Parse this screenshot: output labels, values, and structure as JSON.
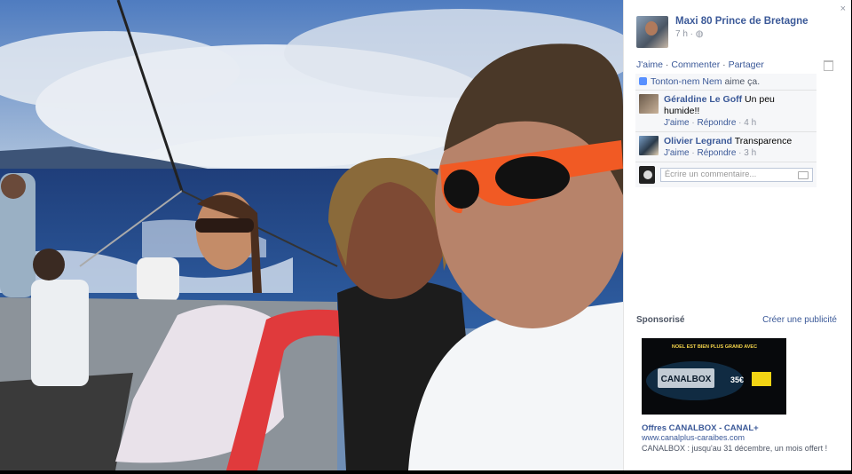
{
  "post": {
    "author": "Maxi 80 Prince de Bretagne",
    "time": "7 h · ",
    "audience_icon": "globe-icon",
    "like_action": "J'aime",
    "comment_action": "Commenter",
    "share_action": "Partager",
    "separator": " · "
  },
  "likes": {
    "name": "Tonton-nem Nem",
    "text": " aime ça."
  },
  "comments": [
    {
      "name": "Géraldine Le Goff",
      "text": "Un peu humide!!",
      "like": "J'aime",
      "reply": "Répondre",
      "time": "4 h"
    },
    {
      "name": "Olivier Legrand",
      "text": "Transparence",
      "like": "J'aime",
      "reply": "Répondre",
      "time": "3 h"
    }
  ],
  "composer": {
    "placeholder": "Écrire un commentaire..."
  },
  "sponsored": {
    "title": "Sponsorisé",
    "create_ad": "Créer une publicité",
    "ad": {
      "headline": "NOEL EST BIEN PLUS GRAND AVEC",
      "brand": "CANALBOX",
      "price": "35€",
      "title": "Offres CANALBOX - CANAL+",
      "url": "www.canalplus-caraibes.com",
      "description": "CANALBOX : jusqu'au 31 décembre, un mois offert !"
    }
  },
  "colors": {
    "link": "#3b5998",
    "meta": "#9197a3",
    "text": "#4e5665"
  }
}
